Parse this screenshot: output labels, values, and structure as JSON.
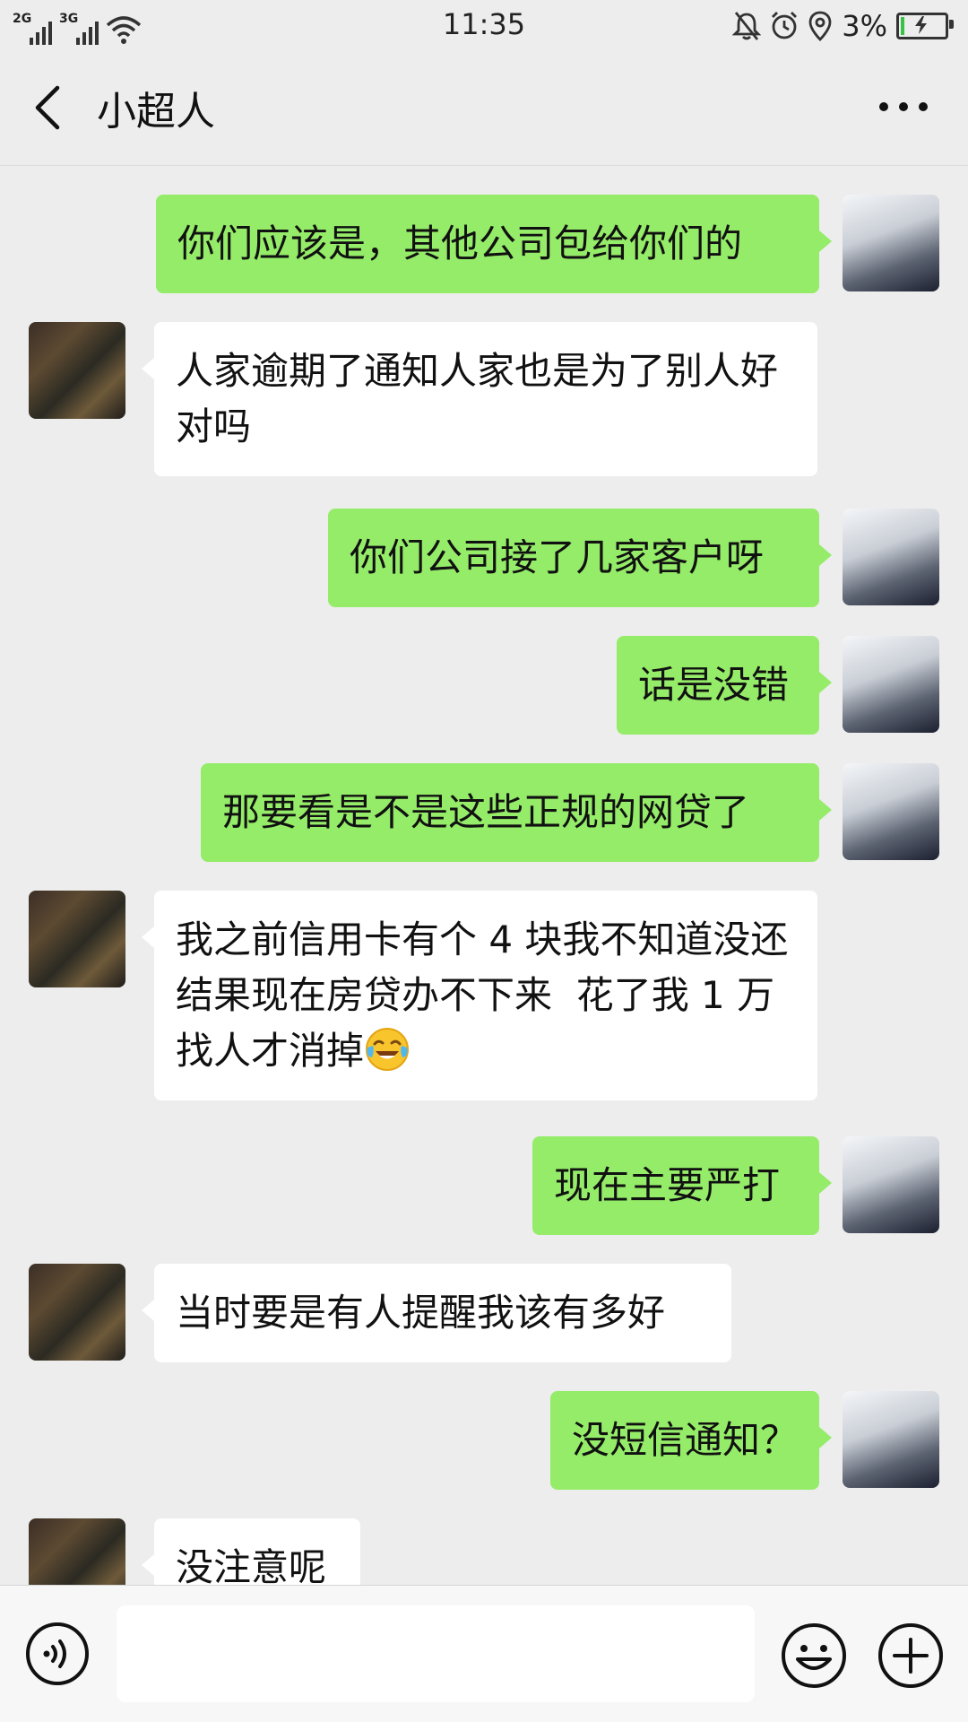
{
  "status_bar": {
    "signal1_label": "2G",
    "signal2_label": "3G",
    "time": "11:35",
    "battery_percent": "3%",
    "icons": [
      "wifi-icon",
      "mute-bell-icon",
      "alarm-icon",
      "location-icon",
      "battery-charging-icon"
    ]
  },
  "header": {
    "title": "小超人",
    "back_icon": "chevron-left-icon",
    "more_icon": "more-dots-icon"
  },
  "messages": [
    {
      "side": "out",
      "text": "你们应该是，其他公司包给你们的"
    },
    {
      "side": "in",
      "text": "人家逾期了通知人家也是为了别人好对吗"
    },
    {
      "side": "out",
      "text": "你们公司接了几家客户呀"
    },
    {
      "side": "out",
      "text": "话是没错"
    },
    {
      "side": "out",
      "text": "那要看是不是这些正规的网贷了"
    },
    {
      "side": "in",
      "text": "我之前信用卡有个 4 块我不知道没还  结果现在房贷办不下来  花了我 1 万找人才消掉",
      "emoji": "face-with-tears-of-joy-emoji"
    },
    {
      "side": "out",
      "text": "现在主要严打"
    },
    {
      "side": "in",
      "text": "当时要是有人提醒我该有多好"
    },
    {
      "side": "out",
      "text": "没短信通知？"
    },
    {
      "side": "in",
      "text": "没注意呢"
    }
  ],
  "input_bar": {
    "value": "",
    "voice_icon": "voice-icon",
    "emoji_icon": "smiley-icon",
    "plus_icon": "plus-icon"
  },
  "colors": {
    "background": "#ededed",
    "outgoing_bubble": "#95ec69",
    "incoming_bubble": "#ffffff"
  }
}
